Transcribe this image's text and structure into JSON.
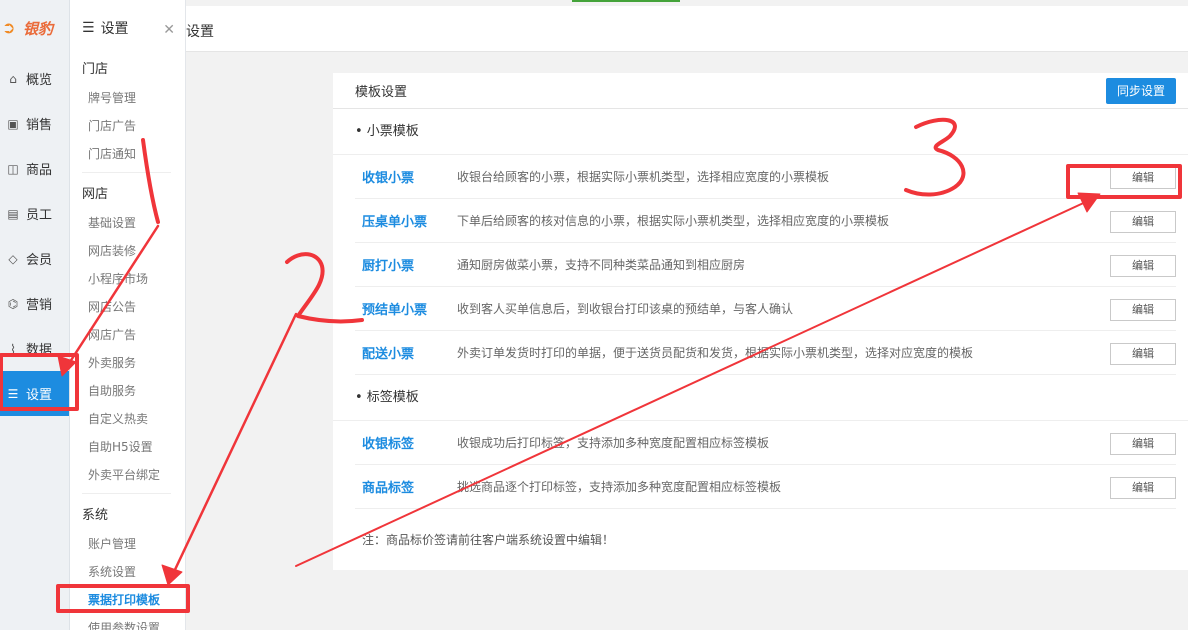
{
  "brand": {
    "name": "银豹"
  },
  "nav": {
    "items": [
      {
        "id": "overview",
        "label": "概览",
        "icon": "home-icon"
      },
      {
        "id": "sales",
        "label": "销售",
        "icon": "register-icon"
      },
      {
        "id": "products",
        "label": "商品",
        "icon": "box-icon"
      },
      {
        "id": "staff",
        "label": "员工",
        "icon": "id-card-icon"
      },
      {
        "id": "members",
        "label": "会员",
        "icon": "diamond-icon"
      },
      {
        "id": "marketing",
        "label": "营销",
        "icon": "gift-icon"
      },
      {
        "id": "data",
        "label": "数据",
        "icon": "chart-icon"
      },
      {
        "id": "settings",
        "label": "设置",
        "icon": "sliders-icon",
        "active": true
      }
    ]
  },
  "submenu": {
    "title": "设置",
    "close_icon": "close-icon",
    "sections": [
      {
        "label": "门店",
        "items": [
          "牌号管理",
          "门店广告",
          "门店通知"
        ]
      },
      {
        "label": "网店",
        "items": [
          "基础设置",
          "网店装修",
          "小程序市场",
          "网店公告",
          "网店广告",
          "外卖服务",
          "自助服务",
          "自定义热卖",
          "自助H5设置",
          "外卖平台绑定"
        ]
      },
      {
        "label": "系统",
        "items": [
          "账户管理",
          "系统设置",
          "票据打印模板",
          "使用参数设置"
        ],
        "current": "票据打印模板"
      }
    ]
  },
  "breadcrumb": "设置",
  "panel": {
    "title": "模板设置",
    "sync_button": "同步设置",
    "edit_label": "编辑",
    "groups": [
      {
        "label": "• 小票模板",
        "rows": [
          {
            "name": "收银小票",
            "desc": "收银台给顾客的小票，根据实际小票机类型，选择相应宽度的小票模板"
          },
          {
            "name": "压桌单小票",
            "desc": "下单后给顾客的核对信息的小票，根据实际小票机类型，选择相应宽度的小票模板"
          },
          {
            "name": "厨打小票",
            "desc": "通知厨房做菜小票，支持不同种类菜品通知到相应厨房"
          },
          {
            "name": "预结单小票",
            "desc": "收到客人买单信息后，到收银台打印该桌的预结单，与客人确认"
          },
          {
            "name": "配送小票",
            "desc": "外卖订单发货时打印的单据，便于送货员配货和发货，根据实际小票机类型，选择对应宽度的模板"
          }
        ]
      },
      {
        "label": "• 标签模板",
        "rows": [
          {
            "name": "收银标签",
            "desc": "收银成功后打印标签，支持添加多种宽度配置相应标签模板"
          },
          {
            "name": "商品标签",
            "desc": "挑选商品逐个打印标签，支持添加多种宽度配置相应标签模板"
          }
        ]
      }
    ],
    "note": "注：商品标价签请前往客户端系统设置中编辑！"
  },
  "colors": {
    "accent": "#1d8ce0",
    "annotation_red": "#f0353a",
    "brand_orange": "#ea6b3a"
  }
}
